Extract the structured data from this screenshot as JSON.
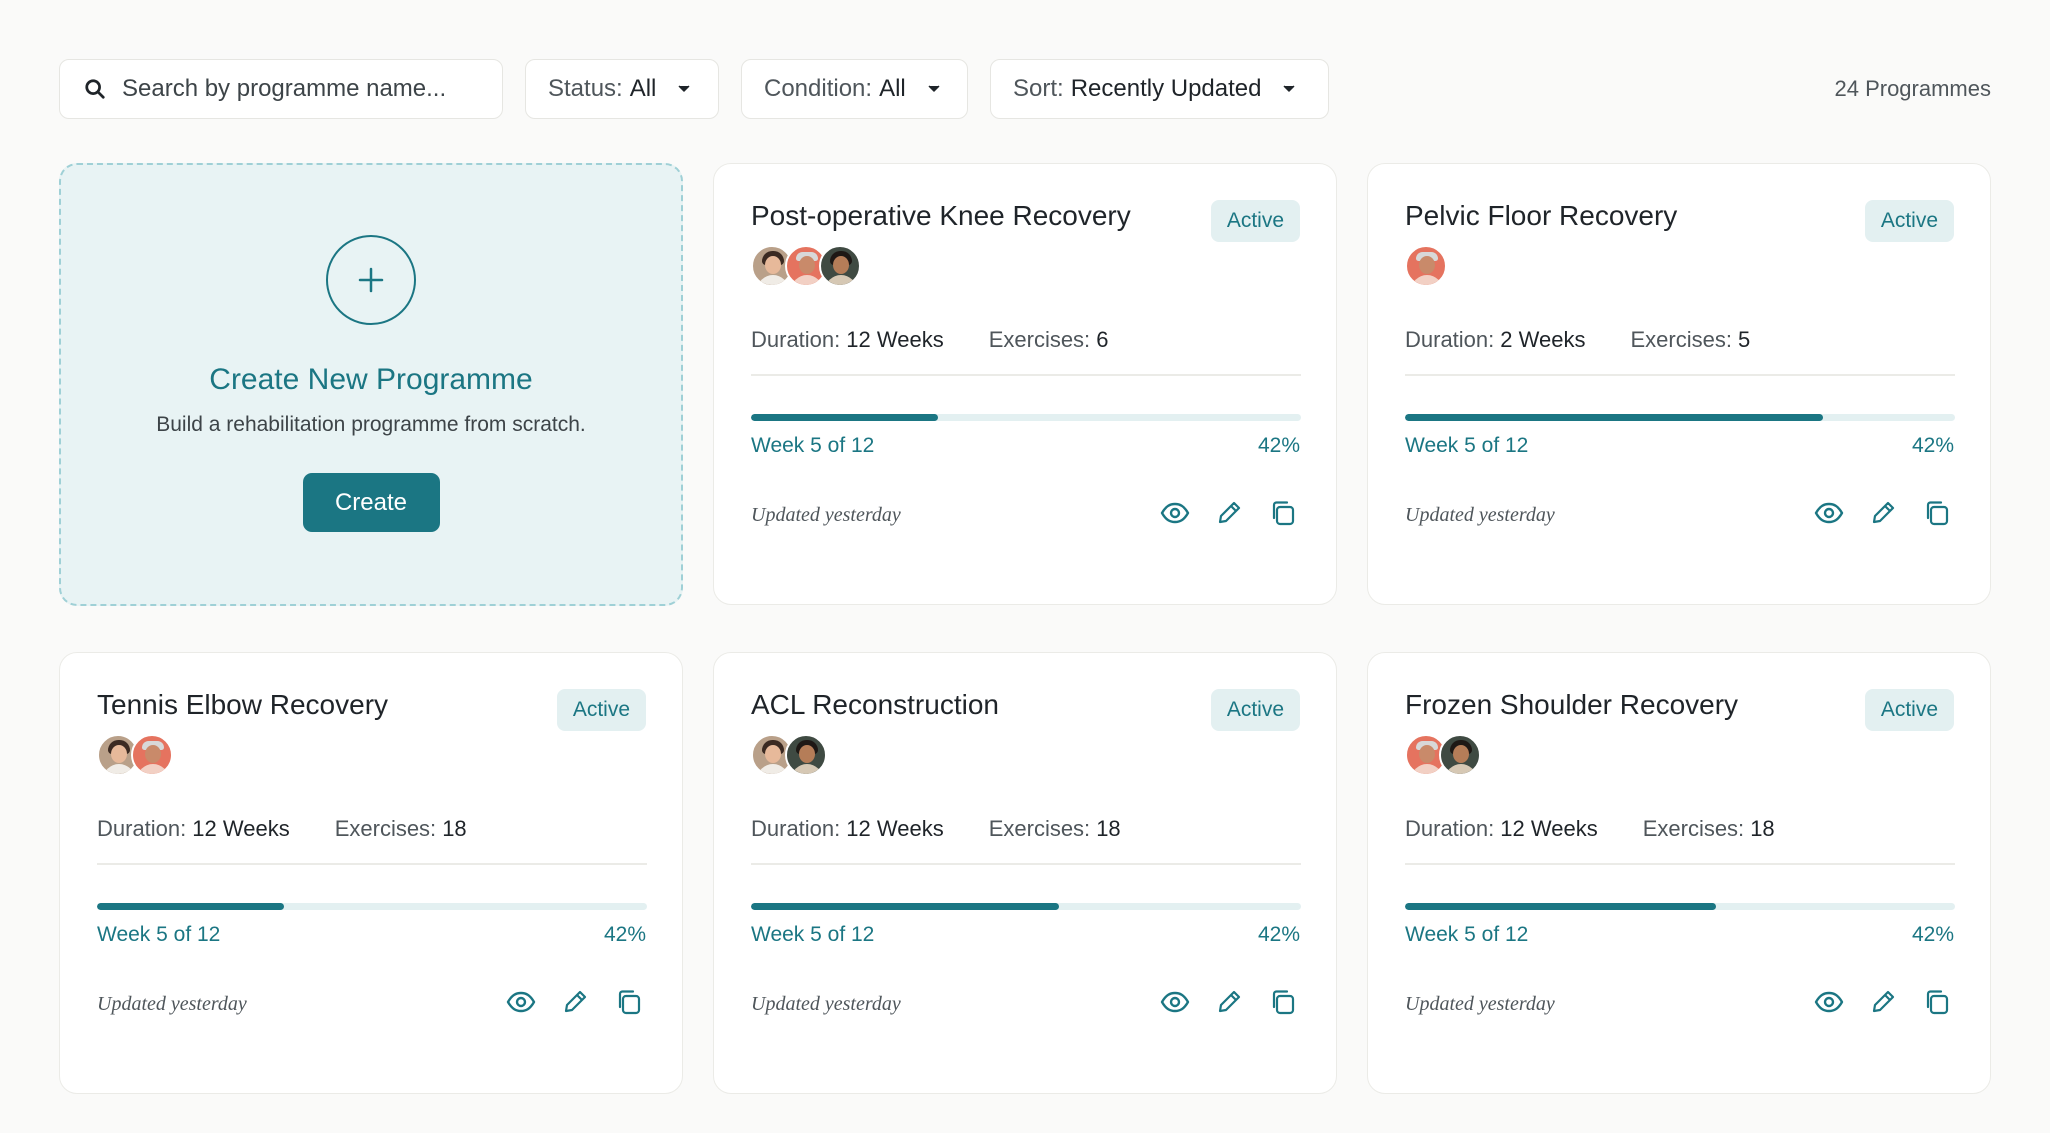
{
  "toolbar": {
    "search_placeholder": "Search by programme name...",
    "status": {
      "label": "Status:",
      "value": "All"
    },
    "condition": {
      "label": "Condition:",
      "value": "All"
    },
    "sort": {
      "label": "Sort:",
      "value": "Recently Updated"
    },
    "count": "24 Programmes"
  },
  "create": {
    "title": "Create New Programme",
    "subtitle": "Build a rehabilitation programme from scratch.",
    "button": "Create"
  },
  "labels": {
    "duration": "Duration:",
    "exercises": "Exercises:"
  },
  "colors": {
    "accent": "#1b7683",
    "badge_bg": "#e3f0f1",
    "create_bg": "#e8f3f4"
  },
  "icons": {
    "search": "search-icon",
    "caret": "chevron-down-icon",
    "plus": "plus-icon",
    "view": "eye-icon",
    "edit": "pencil-icon",
    "duplicate": "copy-icon"
  },
  "programmes": [
    {
      "title": "Post-operative Knee Recovery",
      "status": "Active",
      "duration": "12 Weeks",
      "exercises": "6",
      "week": "Week 5 of 12",
      "percent": "42%",
      "progress": 0.34,
      "updated": "Updated yesterday",
      "avatars": [
        "av-1",
        "av-2",
        "av-3"
      ]
    },
    {
      "title": "Pelvic Floor Recovery",
      "status": "Active",
      "duration": "2 Weeks",
      "exercises": "5",
      "week": "Week 5 of 12",
      "percent": "42%",
      "progress": 0.76,
      "updated": "Updated yesterday",
      "avatars": [
        "av-2"
      ]
    },
    {
      "title": "Tennis Elbow Recovery",
      "status": "Active",
      "duration": "12 Weeks",
      "exercises": "18",
      "week": "Week 5 of 12",
      "percent": "42%",
      "progress": 0.34,
      "updated": "Updated yesterday",
      "avatars": [
        "av-1",
        "av-2"
      ]
    },
    {
      "title": "ACL Reconstruction",
      "status": "Active",
      "duration": "12 Weeks",
      "exercises": "18",
      "week": "Week 5 of 12",
      "percent": "42%",
      "progress": 0.56,
      "updated": "Updated yesterday",
      "avatars": [
        "av-1",
        "av-3"
      ]
    },
    {
      "title": "Frozen Shoulder Recovery",
      "status": "Active",
      "duration": "12 Weeks",
      "exercises": "18",
      "week": "Week 5 of 12",
      "percent": "42%",
      "progress": 0.565,
      "updated": "Updated yesterday",
      "avatars": [
        "av-2",
        "av-3"
      ]
    }
  ]
}
